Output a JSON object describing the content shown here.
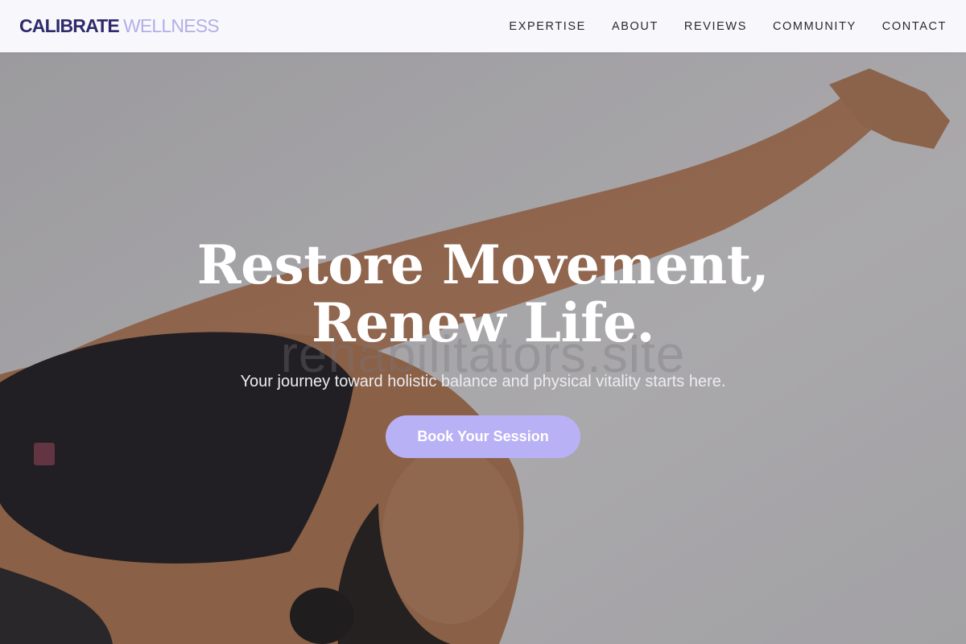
{
  "brand": {
    "name_strong": "CALIBRATE",
    "name_light": "WELLNESS"
  },
  "nav": {
    "items": [
      {
        "label": "EXPERTISE"
      },
      {
        "label": "ABOUT"
      },
      {
        "label": "REVIEWS"
      },
      {
        "label": "COMMUNITY"
      },
      {
        "label": "CONTACT"
      }
    ]
  },
  "hero": {
    "title_line1": "Restore Movement,",
    "title_line2": "Renew Life.",
    "watermark": "rehabilitators.site",
    "subtitle": "Your journey toward holistic balance and physical vitality starts here.",
    "cta_label": "Book Your Session",
    "image_subject": "woman stretching in yoga pose"
  },
  "colors": {
    "brand_dark": "#2e2a6b",
    "brand_light": "#b3aee6",
    "cta": "#b9b1f5",
    "nav_bg": "#f8f8fc"
  }
}
